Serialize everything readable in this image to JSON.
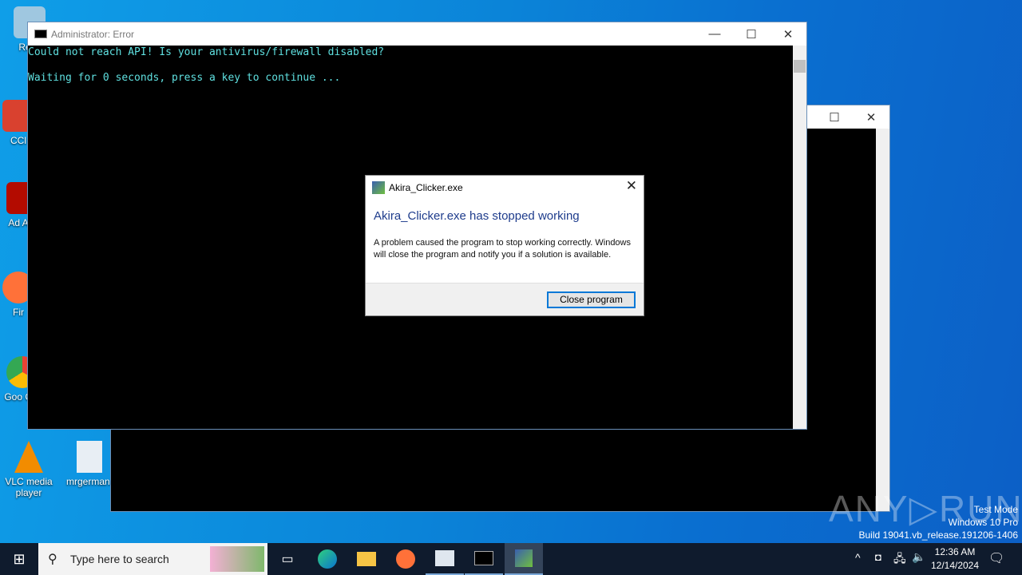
{
  "desktop": {
    "icons": [
      {
        "label": "Recy",
        "color": "#9fc7e0"
      },
      {
        "label": "CCl",
        "color": "#d9412f"
      },
      {
        "label": "Ad Acr",
        "color": "#b30b00"
      },
      {
        "label": "Fir",
        "color": "#ff7139"
      },
      {
        "label": "Goo Chr",
        "color": "#34a853"
      },
      {
        "label": "VLC media player",
        "color": "#f28c00"
      },
      {
        "label": "mrgerman.",
        "color": "#e8eef4"
      }
    ]
  },
  "console_front": {
    "title": "Administrator: Error",
    "lines": [
      "Could not reach API! Is your antivirus/firewall disabled?",
      "",
      "Waiting for 0 seconds, press a key to continue ..."
    ]
  },
  "dialog": {
    "title": "Akira_Clicker.exe",
    "heading": "Akira_Clicker.exe has stopped working",
    "body": "A problem caused the program to stop working correctly. Windows will close the program and notify you if a solution is available.",
    "button": "Close program",
    "heading_color": "#1e3c8c"
  },
  "watermark": {
    "logo": "ANY RUN",
    "lines": [
      "Test Mode",
      "Windows 10 Pro",
      "Build 19041.vb_release.191206-1406"
    ]
  },
  "taskbar": {
    "search_placeholder": "Type here to search",
    "time": "12:36 AM",
    "date": "12/14/2024"
  }
}
